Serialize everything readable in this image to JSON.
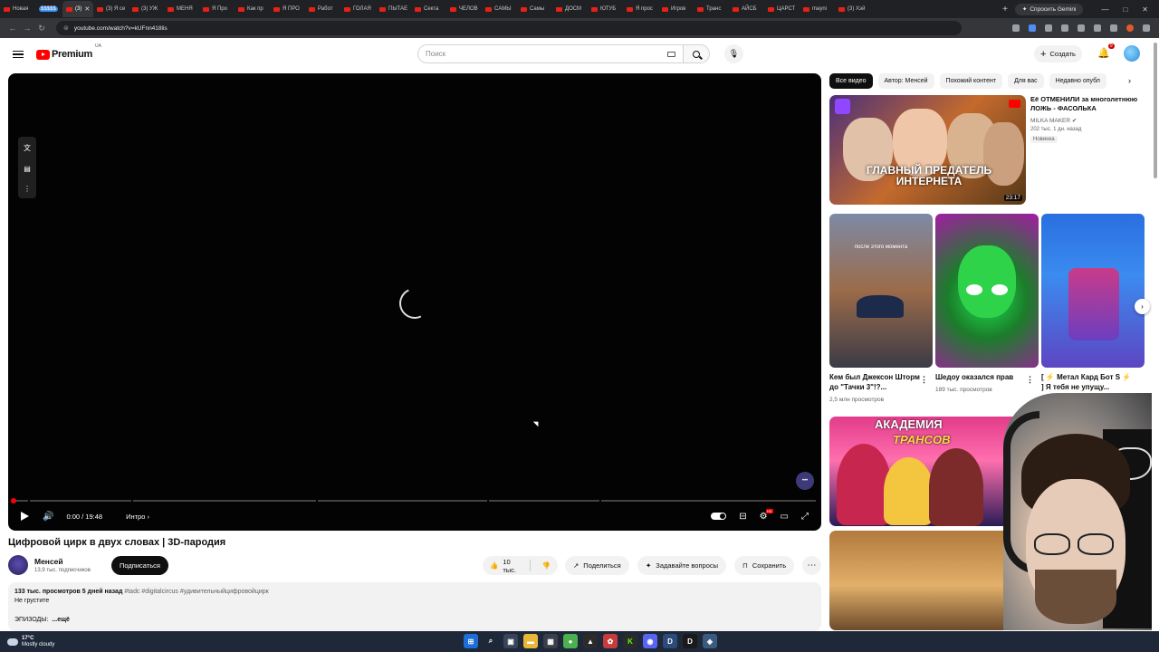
{
  "browser": {
    "tabs": [
      {
        "label": "Новая"
      },
      {
        "label": "$$$$$",
        "badge": true
      },
      {
        "label": "(3)",
        "active": true
      },
      {
        "label": "(3) Я се"
      },
      {
        "label": "(3) УЖ"
      },
      {
        "label": "МЕНЯ"
      },
      {
        "label": "Я Про"
      },
      {
        "label": "Как пр"
      },
      {
        "label": "Я ПРО"
      },
      {
        "label": "Работ"
      },
      {
        "label": "ГОЛАЯ"
      },
      {
        "label": "ПЫТАЕ"
      },
      {
        "label": "Секта"
      },
      {
        "label": "ЧЕЛОВ"
      },
      {
        "label": "САМЫ"
      },
      {
        "label": "Самы"
      },
      {
        "label": "ДОСМ"
      },
      {
        "label": "ЮТУБ"
      },
      {
        "label": "Я прос"
      },
      {
        "label": "Игров"
      },
      {
        "label": "Транс"
      },
      {
        "label": "АЙСБ"
      },
      {
        "label": "ЦАРСТ"
      },
      {
        "label": "mayni"
      },
      {
        "label": "(3) Хэй"
      }
    ],
    "gemini_label": "Спросить Gemini",
    "url": "youtube.com/watch?v=kUFnn418lis"
  },
  "header": {
    "logo_text": "Premium",
    "country": "UA",
    "search_placeholder": "Поиск",
    "create_label": "Создать",
    "notif_count": "9"
  },
  "player": {
    "time": "0:00 / 19:48",
    "chapter": "Интро",
    "progress_fraction": 0.0,
    "hd_badge": "HD"
  },
  "video": {
    "title": "Цифровой цирк в двух словах | 3D-пародия",
    "channel": "Менсей",
    "subscribers": "13,9 тыс. подписчиков",
    "subscribe_label": "Подписаться",
    "likes": "10 тыс.",
    "share_label": "Поделиться",
    "ask_label": "Задавайте вопросы",
    "save_label": "Сохранить",
    "desc_meta": "133 тыс. просмотров  5 дней назад",
    "desc_tags": "#tadc #digitalcircus #удивительныйцифровойцирк",
    "desc_line": "Не грустите",
    "desc_ep": "ЭПИЗОДЫ:",
    "desc_more": "...ещё"
  },
  "sidebar": {
    "chips": [
      "Все видео",
      "Автор: Менсей",
      "Похожий контент",
      "Для вас",
      "Недавно опубл"
    ],
    "rec1": {
      "title": "Её ОТМЕНИЛИ за многолетнюю ЛОЖЬ - ФАСОЛЬКА",
      "channel": "MILKA MAKER",
      "stats": "202 тыс.  1 дн. назад",
      "badge": "Новинка",
      "thumb_text": "ГЛАВНЫЙ ПРЕДАТЕЛЬ ИНТЕРНЕТА",
      "duration": "23:17"
    },
    "shorts": [
      {
        "title": "Кем был Джексон Шторм до \"Тачки 3\"!?...",
        "views": "2,5 млн просмотров",
        "caption": "после этого момента"
      },
      {
        "title": "Шедоу оказался прав",
        "views": "189 тыс. просмотров",
        "caption": ""
      },
      {
        "title": "[ ⚡ Метал Кард Бот S ⚡ ] Я тебя не упущу...",
        "views": "",
        "caption": ""
      }
    ],
    "rec2": {
      "thumb_text1": "АКАДЕМИЯ",
      "thumb_text2": "ТРАНСОВ"
    }
  },
  "taskbar": {
    "temp": "17°C",
    "weather": "Mostly cloudy"
  }
}
